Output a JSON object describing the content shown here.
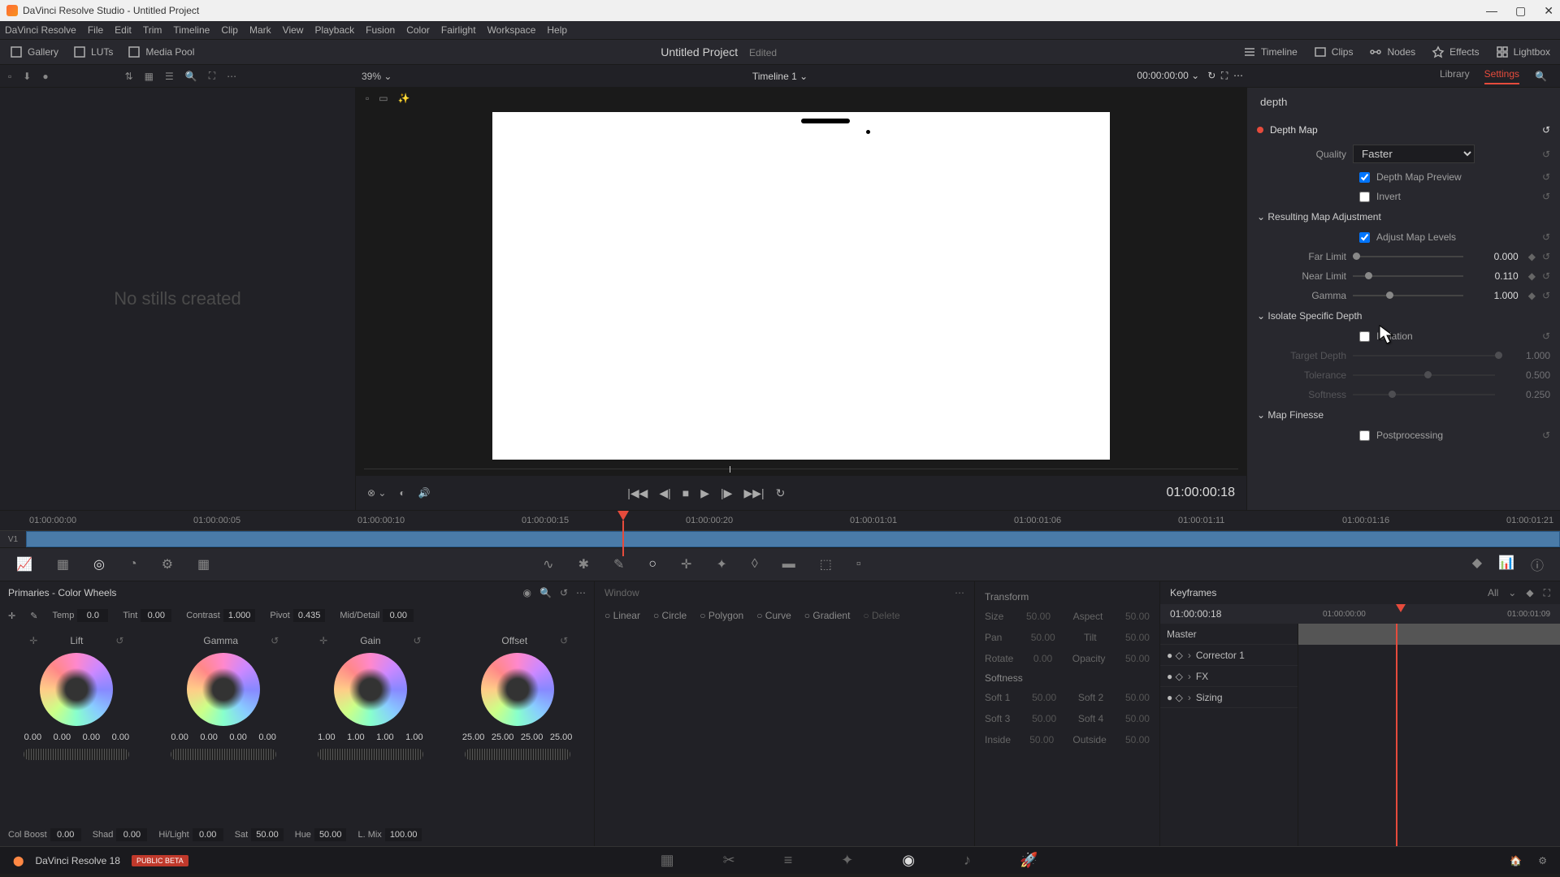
{
  "titlebar": {
    "title": "DaVinci Resolve Studio - Untitled Project"
  },
  "menubar": [
    "DaVinci Resolve",
    "File",
    "Edit",
    "Trim",
    "Timeline",
    "Clip",
    "Mark",
    "View",
    "Playback",
    "Fusion",
    "Color",
    "Fairlight",
    "Workspace",
    "Help"
  ],
  "top_toolbar": {
    "gallery": "Gallery",
    "luts": "LUTs",
    "mediapool": "Media Pool",
    "project": "Untitled Project",
    "edited": "Edited",
    "timeline": "Timeline",
    "clips": "Clips",
    "nodes": "Nodes",
    "effects": "Effects",
    "lightbox": "Lightbox"
  },
  "sec_toolbar": {
    "zoom": "39%",
    "timeline_name": "Timeline 1",
    "timecode": "00:00:00:00",
    "library": "Library",
    "settings": "Settings"
  },
  "gallery": {
    "no_stills": "No stills created"
  },
  "viewer": {
    "timecode": "01:00:00:18"
  },
  "ruler_tcs": [
    "01:00:00:00",
    "01:00:00:05",
    "01:00:00:10",
    "01:00:00:15",
    "01:00:00:20",
    "01:00:01:01",
    "01:00:01:06",
    "01:00:01:11",
    "01:00:01:16",
    "01:00:01:21"
  ],
  "track_label": "V1",
  "settings": {
    "search": "depth",
    "depth_map": "Depth Map",
    "quality_label": "Quality",
    "quality_value": "Faster",
    "preview": "Depth Map Preview",
    "invert": "Invert",
    "rma": "Resulting Map Adjustment",
    "adjust_levels": "Adjust Map Levels",
    "far_limit": "Far Limit",
    "far_limit_v": "0.000",
    "near_limit": "Near Limit",
    "near_limit_v": "0.110",
    "gamma": "Gamma",
    "gamma_v": "1.000",
    "isolate": "Isolate Specific Depth",
    "isolation": "Isolation",
    "target_depth": "Target Depth",
    "target_depth_v": "1.000",
    "tolerance": "Tolerance",
    "tolerance_v": "0.500",
    "softness": "Softness",
    "softness_v": "0.250",
    "map_finesse": "Map Finesse",
    "postprocessing": "Postprocessing"
  },
  "primaries": {
    "title": "Primaries - Color Wheels",
    "params": {
      "temp": "Temp",
      "temp_v": "0.0",
      "tint": "Tint",
      "tint_v": "0.00",
      "contrast": "Contrast",
      "contrast_v": "1.000",
      "pivot": "Pivot",
      "pivot_v": "0.435",
      "md": "Mid/Detail",
      "md_v": "0.00"
    },
    "wheels": {
      "lift": {
        "label": "Lift",
        "nums": [
          "0.00",
          "0.00",
          "0.00",
          "0.00"
        ]
      },
      "gamma": {
        "label": "Gamma",
        "nums": [
          "0.00",
          "0.00",
          "0.00",
          "0.00"
        ]
      },
      "gain": {
        "label": "Gain",
        "nums": [
          "1.00",
          "1.00",
          "1.00",
          "1.00"
        ]
      },
      "offset": {
        "label": "Offset",
        "nums": [
          "25.00",
          "25.00",
          "25.00",
          "25.00"
        ]
      }
    },
    "footer": {
      "colboost": "Col Boost",
      "colboost_v": "0.00",
      "shad": "Shad",
      "shad_v": "0.00",
      "hilight": "Hi/Light",
      "hilight_v": "0.00",
      "sat": "Sat",
      "sat_v": "50.00",
      "hue": "Hue",
      "hue_v": "50.00",
      "lmix": "L. Mix",
      "lmix_v": "100.00"
    }
  },
  "center": {
    "window": "Window",
    "tabs": [
      "Linear",
      "Circle",
      "Polygon",
      "Curve",
      "Gradient"
    ],
    "delete": "Delete"
  },
  "sizing": {
    "transform": "Transform",
    "rows1": [
      [
        "Size",
        "50.00"
      ],
      [
        "Aspect",
        "50.00"
      ],
      [
        "Pan",
        "50.00"
      ],
      [
        "Tilt",
        "50.00"
      ],
      [
        "Rotate",
        "0.00"
      ],
      [
        "Opacity",
        "50.00"
      ]
    ],
    "softness": "Softness",
    "rows2": [
      [
        "Soft 1",
        "50.00"
      ],
      [
        "Soft 2",
        "50.00"
      ],
      [
        "Soft 3",
        "50.00"
      ],
      [
        "Soft 4",
        "50.00"
      ],
      [
        "Inside",
        "50.00"
      ],
      [
        "Outside",
        "50.00"
      ]
    ]
  },
  "keyframes": {
    "title": "Keyframes",
    "all": "All",
    "tc": "01:00:00:18",
    "ruler": [
      "01:00:00:00",
      "01:00:01:09"
    ],
    "tracks": [
      "Master",
      "Corrector 1",
      "FX",
      "Sizing"
    ]
  },
  "bottom_nav": {
    "app": "DaVinci Resolve 18",
    "beta": "PUBLIC BETA"
  }
}
